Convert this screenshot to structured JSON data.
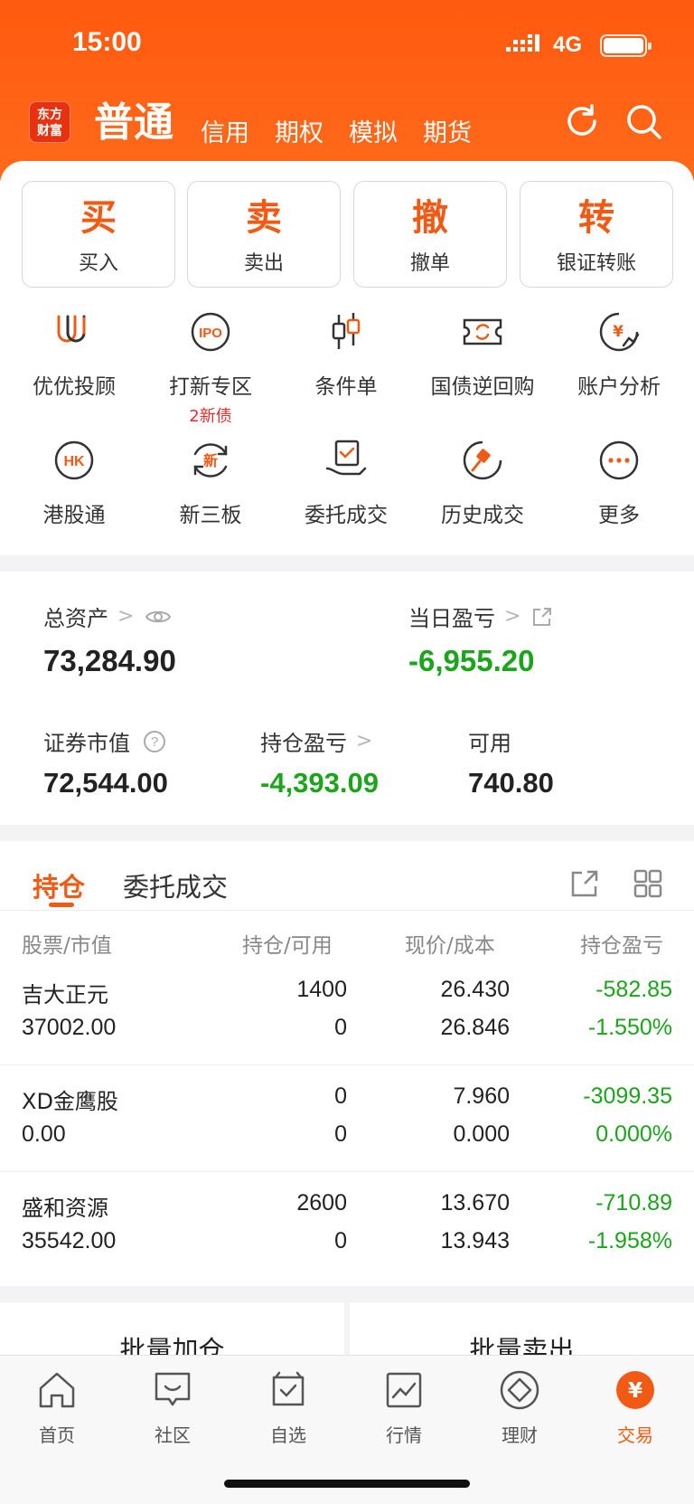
{
  "status": {
    "time": "15:00",
    "network": "4G"
  },
  "header": {
    "logo_line1": "东方",
    "logo_line2": "财富",
    "tabs": [
      "普通",
      "信用",
      "期权",
      "模拟",
      "期货"
    ],
    "icons": [
      "refresh-icon",
      "search-icon"
    ]
  },
  "actions": [
    {
      "glyph": "买",
      "label": "买入"
    },
    {
      "glyph": "卖",
      "label": "卖出"
    },
    {
      "glyph": "撤",
      "label": "撤单"
    },
    {
      "glyph": "转",
      "label": "银证转账"
    }
  ],
  "grid": [
    {
      "label": "优优投顾",
      "icon": "youyou-icon"
    },
    {
      "label": "打新专区",
      "icon": "ipo-icon",
      "sub": "2新债"
    },
    {
      "label": "条件单",
      "icon": "candlestick-icon"
    },
    {
      "label": "国债逆回购",
      "icon": "repo-ticket-icon"
    },
    {
      "label": "账户分析",
      "icon": "yuan-chart-icon"
    },
    {
      "label": "港股通",
      "icon": "hk-icon"
    },
    {
      "label": "新三板",
      "icon": "new-board-icon"
    },
    {
      "label": "委托成交",
      "icon": "entrust-icon"
    },
    {
      "label": "历史成交",
      "icon": "history-gavel-icon"
    },
    {
      "label": "更多",
      "icon": "more-icon"
    }
  ],
  "assets": {
    "total_label": "总资产",
    "total_value": "73,284.90",
    "daily_label": "当日盈亏",
    "daily_value": "-6,955.20",
    "market_label": "证券市值",
    "market_value": "72,544.00",
    "holding_label": "持仓盈亏",
    "holding_value": "-4,393.09",
    "available_label": "可用",
    "available_value": "740.80"
  },
  "positions": {
    "tabs": [
      "持仓",
      "委托成交"
    ],
    "headers": [
      "股票/市值",
      "持仓/可用",
      "现价/成本",
      "持仓盈亏"
    ],
    "rows": [
      {
        "name": "吉大正元",
        "value": "37002.00",
        "qty": "1400",
        "avail": "0",
        "price": "26.430",
        "cost": "26.846",
        "pl": "-582.85",
        "pl_pct": "-1.550%"
      },
      {
        "name": "XD金鹰股",
        "value": "0.00",
        "qty": "0",
        "avail": "0",
        "price": "7.960",
        "cost": "0.000",
        "pl": "-3099.35",
        "pl_pct": "0.000%"
      },
      {
        "name": "盛和资源",
        "value": "35542.00",
        "qty": "2600",
        "avail": "0",
        "price": "13.670",
        "cost": "13.943",
        "pl": "-710.89",
        "pl_pct": "-1.958%"
      }
    ]
  },
  "batch": {
    "add": "批量加仓",
    "sell": "批量卖出"
  },
  "tabbar": [
    {
      "label": "首页",
      "icon": "home-icon"
    },
    {
      "label": "社区",
      "icon": "community-icon"
    },
    {
      "label": "自选",
      "icon": "watchlist-icon"
    },
    {
      "label": "行情",
      "icon": "market-icon"
    },
    {
      "label": "理财",
      "icon": "wealth-icon"
    },
    {
      "label": "交易",
      "icon": "trade-icon"
    }
  ],
  "colors": {
    "brand": "#ff5a0f",
    "accent": "#f05a14",
    "loss": "#1aa51a",
    "hint": "#e52d2d"
  }
}
